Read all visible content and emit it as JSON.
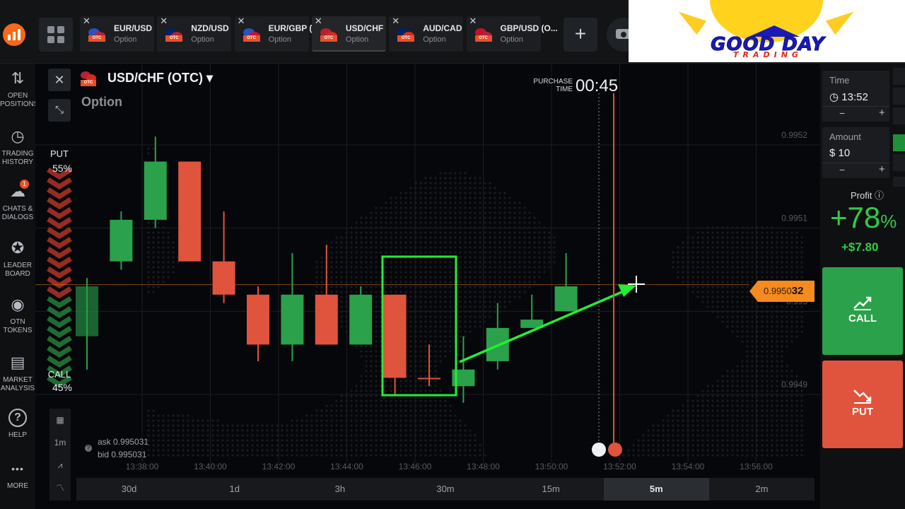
{
  "brand": {
    "logo_color": "#f26a1b"
  },
  "tabs": [
    {
      "pair": "EUR/USD",
      "sub": "Option",
      "flag_a": "#2a52be",
      "flag_b": "#b22234",
      "active": false
    },
    {
      "pair": "NZD/USD",
      "sub": "Option",
      "flag_a": "#012169",
      "flag_b": "#b22234",
      "active": false
    },
    {
      "pair": "EUR/GBP (",
      "sub": "Option",
      "flag_a": "#2a52be",
      "flag_b": "#c8102e",
      "active": false
    },
    {
      "pair": "USD/CHF",
      "sub": "Option",
      "flag_a": "#b22234",
      "flag_b": "#d52b1e",
      "active": true
    },
    {
      "pair": "AUD/CAD",
      "sub": "Option",
      "flag_a": "#012169",
      "flag_b": "#d52b1e",
      "active": false
    },
    {
      "pair": "GBP/USD (O...",
      "sub": "Option",
      "flag_a": "#c8102e",
      "flag_b": "#b22234",
      "active": false
    }
  ],
  "banner": {
    "title": "GOOD DAY",
    "subtitle": "TRADING"
  },
  "sidebar": [
    {
      "icon": "arrows-updown-icon",
      "glyph": "⇅",
      "label": "OPEN\nPOSITIONS"
    },
    {
      "icon": "history-icon",
      "glyph": "◷",
      "label": "TRADING\nHISTORY"
    },
    {
      "icon": "chat-icon",
      "glyph": "☁",
      "label": "CHATS &\nDIALOGS",
      "badge": "1"
    },
    {
      "icon": "trophy-icon",
      "glyph": "✪",
      "label": "LEADER\nBOARD"
    },
    {
      "icon": "token-icon",
      "glyph": "◉",
      "label": "OTN\nTOKENS"
    },
    {
      "icon": "analysis-icon",
      "glyph": "▤",
      "label": "MARKET\nANALYSIS"
    },
    {
      "icon": "help-icon",
      "glyph": "?",
      "label": "HELP"
    },
    {
      "icon": "more-icon",
      "glyph": "•••",
      "label": "MORE"
    }
  ],
  "asset": {
    "title": "USD/CHF (OTC) ▾",
    "type": "Option"
  },
  "purchase": {
    "label": "PURCHASE\nTIME",
    "time": "00:45"
  },
  "sentiment": {
    "put_label": "PUT",
    "put_pct": "55%",
    "call_label": "CALL",
    "call_pct": "45%",
    "put_value": 0.55
  },
  "quote": {
    "ask": "ask 0.995031",
    "bid": "bid 0.995031",
    "price_main": "0.9950",
    "price_tail": "32"
  },
  "tools": [
    "▦",
    "1m",
    "⩘",
    "〽"
  ],
  "timeframes": [
    {
      "label": "30d",
      "active": false
    },
    {
      "label": "1d",
      "active": false
    },
    {
      "label": "3h",
      "active": false
    },
    {
      "label": "30m",
      "active": false
    },
    {
      "label": "15m",
      "active": false
    },
    {
      "label": "5m",
      "active": true
    },
    {
      "label": "2m",
      "active": false
    }
  ],
  "right": {
    "time_label": "Time",
    "time_value": "◷ 13:52",
    "amount_label": "Amount",
    "amount_value": "$ 10",
    "minus": "−",
    "plus": "+",
    "profit_label": "Profit ⓘ",
    "profit_pct": "+78",
    "profit_pct_unit": "%",
    "profit_amount": "+$7.80",
    "call_label": "CALL",
    "put_label": "PUT"
  },
  "colors": {
    "up": "#2aa14a",
    "down": "#e0533c",
    "price_line": "#f58a1f",
    "highlight": "#22ee33",
    "expiry_line": "#e0533c"
  },
  "chart_data": {
    "type": "candlestick",
    "y_ticks": [
      "0.9952",
      "0.9951",
      "0.995",
      "0.9949"
    ],
    "x_ticks": [
      "13:38:00",
      "13:40:00",
      "13:42:00",
      "13:44:00",
      "13:46:00",
      "13:48:00",
      "13:50:00",
      "13:52:00",
      "13:54:00",
      "13:56:00"
    ],
    "current_price": 0.995032,
    "candles": [
      {
        "dir": "up",
        "open": 0.99497,
        "close": 0.99503,
        "high": 0.99504,
        "low": 0.99493
      },
      {
        "dir": "up",
        "open": 0.99506,
        "close": 0.99511,
        "high": 0.99512,
        "low": 0.99505
      },
      {
        "dir": "up",
        "open": 0.99511,
        "close": 0.99518,
        "high": 0.99521,
        "low": 0.9951
      },
      {
        "dir": "down",
        "open": 0.99518,
        "close": 0.99506,
        "high": 0.99518,
        "low": 0.99506
      },
      {
        "dir": "down",
        "open": 0.99506,
        "close": 0.99502,
        "high": 0.99512,
        "low": 0.99501
      },
      {
        "dir": "down",
        "open": 0.99502,
        "close": 0.99496,
        "high": 0.99503,
        "low": 0.99494
      },
      {
        "dir": "up",
        "open": 0.99496,
        "close": 0.99502,
        "high": 0.99507,
        "low": 0.99494
      },
      {
        "dir": "down",
        "open": 0.99502,
        "close": 0.99496,
        "high": 0.99508,
        "low": 0.99496
      },
      {
        "dir": "up",
        "open": 0.99496,
        "close": 0.99502,
        "high": 0.99503,
        "low": 0.99496
      },
      {
        "dir": "down",
        "open": 0.99502,
        "close": 0.99492,
        "high": 0.99502,
        "low": 0.9949
      },
      {
        "dir": "down",
        "open": 0.99492,
        "close": 0.99492,
        "high": 0.99496,
        "low": 0.99491
      },
      {
        "dir": "up",
        "open": 0.99491,
        "close": 0.99493,
        "high": 0.99497,
        "low": 0.99489
      },
      {
        "dir": "up",
        "open": 0.99494,
        "close": 0.99498,
        "high": 0.99501,
        "low": 0.99493
      },
      {
        "dir": "up",
        "open": 0.99498,
        "close": 0.99499,
        "high": 0.99502,
        "low": 0.99498
      },
      {
        "dir": "up",
        "open": 0.995,
        "close": 0.99503,
        "high": 0.99507,
        "low": 0.995
      }
    ]
  }
}
